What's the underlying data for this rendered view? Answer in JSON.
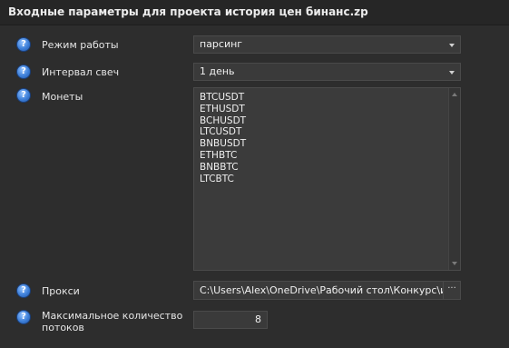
{
  "title": "Входные параметры для проекта история цен бинанс.zp",
  "fields": {
    "mode": {
      "label": "Режим работы",
      "value": "парсинг",
      "icon": "help-icon"
    },
    "interval": {
      "label": "Интервал свеч",
      "value": "1 день",
      "icon": "help-icon"
    },
    "coins": {
      "label": "Монеты",
      "lines": [
        "BTCUSDT",
        "ETHUSDT",
        "BCHUSDT",
        "LTCUSDT",
        "BNBUSDT",
        "ETHBTC",
        "BNBBTC",
        "LTCBTC"
      ],
      "icon": "help-icon"
    },
    "proxy": {
      "label": "Прокси",
      "value": "C:\\Users\\Alex\\OneDrive\\Рабочий стол\\Конкурс\\истор",
      "browse_label": "···",
      "icon": "help-icon"
    },
    "threads": {
      "label": "Максимальное количество потоков",
      "value": "8",
      "icon": "help-icon"
    }
  },
  "help_glyph": "?"
}
